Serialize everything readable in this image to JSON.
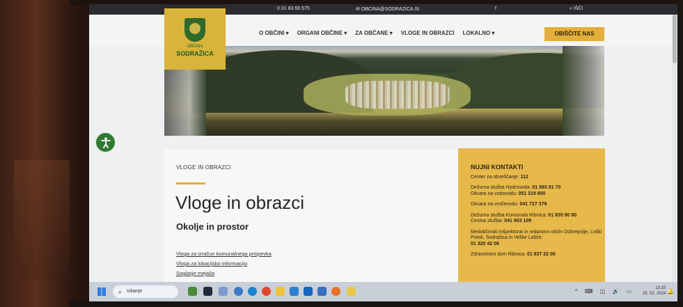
{
  "topbar": {
    "phone": "0 01 83 66 575",
    "email": "✉ OBCINA@SODRAZICA.SI",
    "facebook": "f",
    "search": "⌕ IŠČI"
  },
  "logo": {
    "line1": "OBČINA",
    "line2": "SODRAŽICA"
  },
  "nav": {
    "items": [
      {
        "label": "O OBČINI ▾"
      },
      {
        "label": "ORGANI OBČINE ▾"
      },
      {
        "label": "ZA OBČANE ▾"
      },
      {
        "label": "VLOGE IN OBRAZCI"
      },
      {
        "label": "LOKALNO ▾"
      }
    ],
    "cta": "OBIŠČITE NAS"
  },
  "main": {
    "breadcrumb": "VLOGE IN OBRAZCI",
    "title": "Vloge in obrazci",
    "subtitle": "Okolje in prostor",
    "links": [
      "Vloga za izračun komunalnega prispevka",
      "Vloga za lokacijsko informacijo",
      "Soglasje mejaša"
    ]
  },
  "sidebar": {
    "title": "NUJNI KONTAKTI",
    "items": [
      {
        "label": "Center za obveščanje:",
        "value": "112"
      },
      {
        "label": "Dežurna služba Hydrovoda:",
        "value": "01 893 81 70",
        "label2": "Okvara na vodovodu:",
        "value2": "051 319 800"
      },
      {
        "label": "Okvara na vročevodu:",
        "value": "041 727 379"
      },
      {
        "label": "Dežurna služba Komunala Ribnica:",
        "value": "01 835 90 80",
        "label2": "Cestna služba:",
        "value2": "041 903 109"
      },
      {
        "label": "Medobčinski inšpektorat in redarstvo občin Dobrepolje, Loški Potok, Sodražica in Velike Lašče:",
        "value": "01 320 42 08"
      },
      {
        "label": "Zdravstveni dom Ribnica:",
        "value": "01 837 22 00"
      }
    ]
  },
  "taskbar": {
    "search_label": "Iskanje",
    "tray": "^ ⌨ ◫ 🔊 ▭",
    "time": "13:10",
    "date": "25. 02. 2024"
  },
  "colors": {
    "accent": "#e3ae3a",
    "sidebar": "#e6b94a",
    "topbar": "#2c2b30",
    "logo_green": "#1e5b2a"
  }
}
